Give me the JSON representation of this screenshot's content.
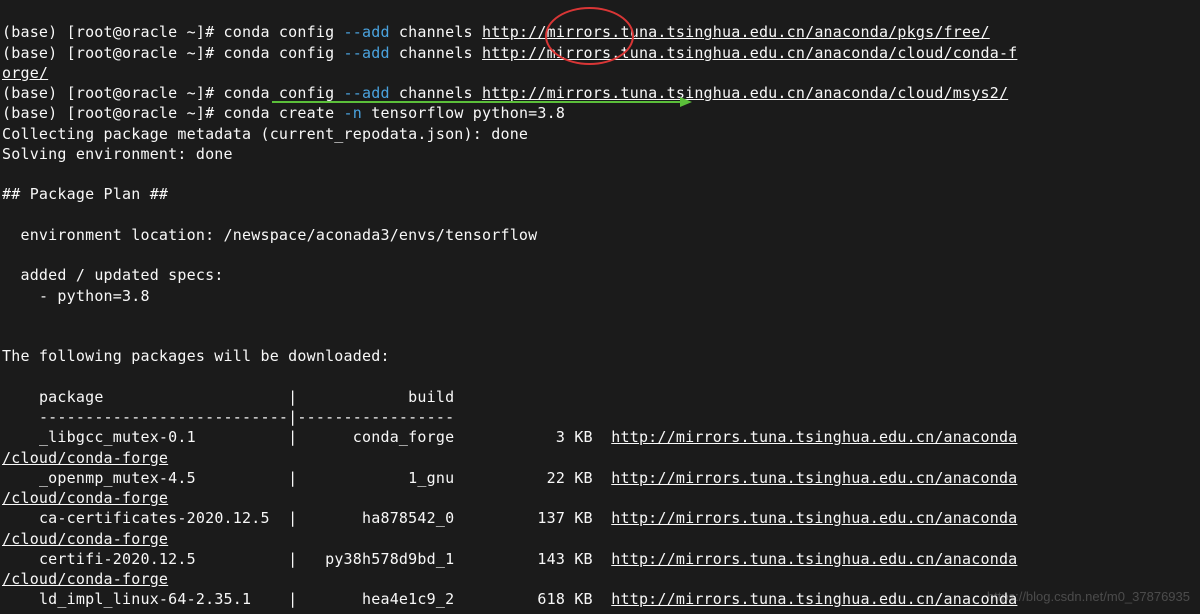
{
  "prompt_prefix": "(base) [root@oracle ~]# ",
  "cmd": {
    "conda_config": "conda config ",
    "add_flag": "--add",
    "channels_word": " channels ",
    "conda_create": "conda create ",
    "n_flag": "-n",
    "tensorflow_env": " tensorflow python=3.8"
  },
  "urls": {
    "free": "http://mirrors.tuna.tsinghua.edu.cn/anaconda/pkgs/free/",
    "forge_a": "http://mirrors.tuna.tsinghua.edu.cn/anaconda/cloud/conda-f",
    "forge_b": "orge/",
    "msys2": "http://mirrors.tuna.tsinghua.edu.cn/anaconda/cloud/msys2/",
    "base": "http://mirrors.tuna.tsinghua.edu.cn/anaconda",
    "sub_forge": "/cloud/conda-forge",
    "last": "http://mirrors.tuna.tsinghua.edu.cn/anaconda"
  },
  "lines": {
    "collecting": "Collecting package metadata (current_repodata.json): done",
    "solving": "Solving environment: done",
    "plan": "## Package Plan ##",
    "envloc": "  environment location: /newspace/aconada3/envs/tensorflow",
    "added": "  added / updated specs:",
    "spec": "    - python=3.8",
    "following": "The following packages will be downloaded:",
    "header": "    package                    |            build",
    "divider": "    ---------------------------|-----------------"
  },
  "packages": [
    {
      "row": "    _libgcc_mutex-0.1          |      conda_forge           3 KB  "
    },
    {
      "row": "    _openmp_mutex-4.5          |            1_gnu          22 KB  "
    },
    {
      "row": "    ca-certificates-2020.12.5  |       ha878542_0         137 KB  "
    },
    {
      "row": "    certifi-2020.12.5          |   py38h578d9bd_1         143 KB  "
    },
    {
      "row": "    ld_impl_linux-64-2.35.1    |       hea4e1c9_2         618 KB  "
    }
  ],
  "watermark": "https://blog.csdn.net/m0_37876935"
}
